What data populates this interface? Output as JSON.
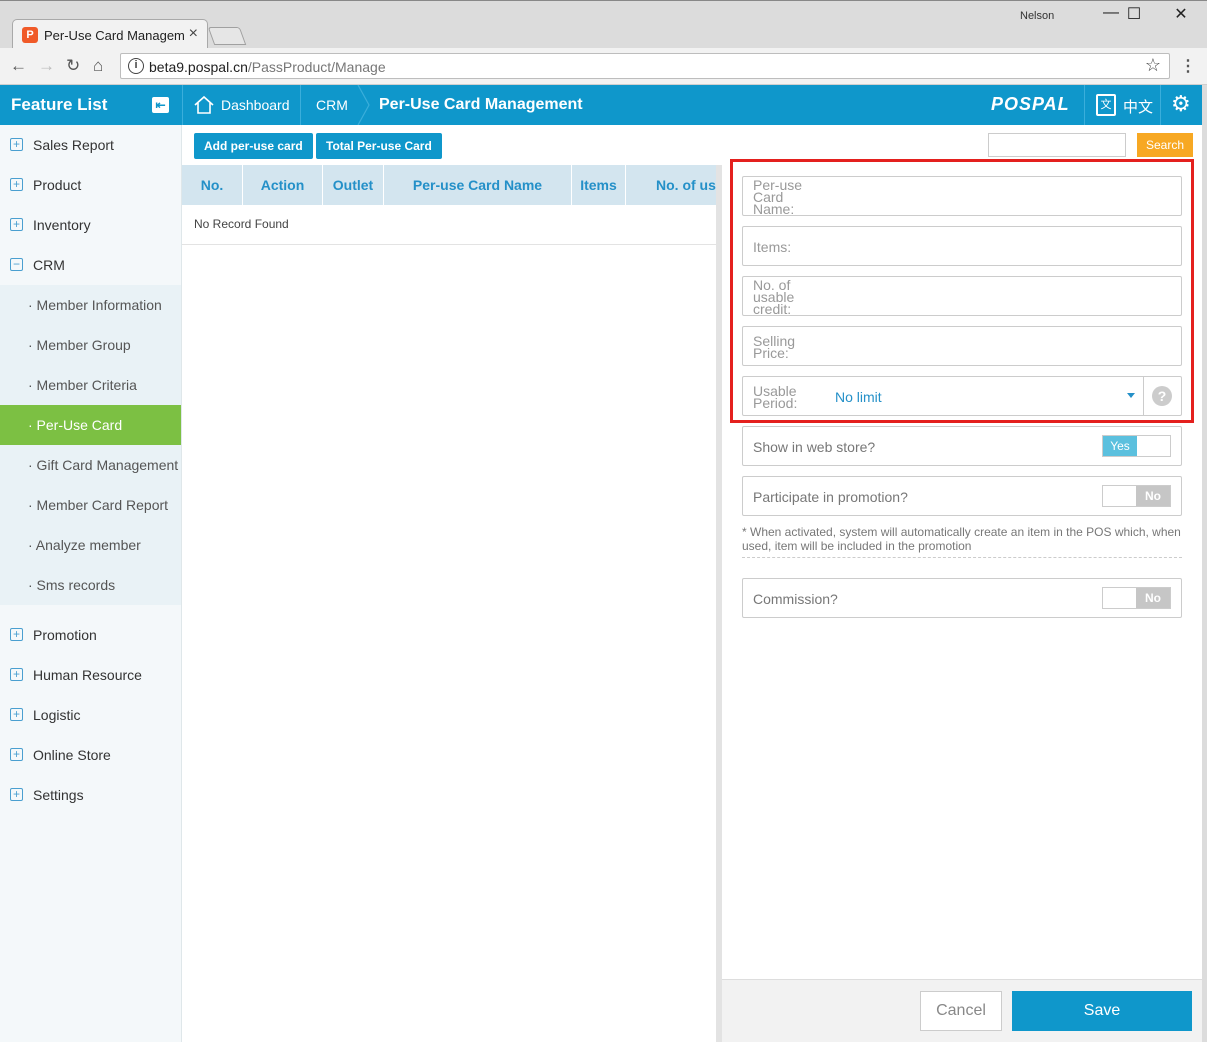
{
  "browser": {
    "tab_title": "Per-Use Card Management",
    "user": "Nelson",
    "url_host": "beta9.pospal.cn",
    "url_path": "/PassProduct/Manage"
  },
  "header": {
    "feature_title": "Feature List",
    "breadcrumbs": [
      "Dashboard",
      "CRM"
    ],
    "page_title": "Per-Use Card Management",
    "brand": "POSPAL",
    "lang_label": "中文",
    "accent_color": "#0f97cb"
  },
  "sidebar": {
    "items": [
      {
        "label": "Sales Report"
      },
      {
        "label": "Product"
      },
      {
        "label": "Inventory"
      },
      {
        "label": "CRM"
      },
      {
        "label": "Promotion"
      },
      {
        "label": "Human Resource"
      },
      {
        "label": "Logistic"
      },
      {
        "label": "Online Store"
      },
      {
        "label": "Settings"
      }
    ],
    "crm_sub": [
      {
        "label": "· Member Information"
      },
      {
        "label": "· Member Group"
      },
      {
        "label": "· Member Criteria"
      },
      {
        "label": "· Per-Use Card",
        "active": true
      },
      {
        "label": "· Gift Card Management"
      },
      {
        "label": "· Member Card Report"
      },
      {
        "label": "· Analyze member"
      },
      {
        "label": "· Sms records"
      }
    ],
    "active_color": "#7cc043"
  },
  "toolbar": {
    "add_label": "Add per-use card",
    "total_label": "Total Per-use Card",
    "search_label": "Search",
    "search_value": ""
  },
  "table": {
    "columns": [
      "No.",
      "Action",
      "Outlet",
      "Per-use Card Name",
      "Items",
      "No. of usable credit"
    ],
    "empty_text": "No Record Found"
  },
  "form": {
    "card_name_label": "Per-use Card Name:",
    "items_label": "Items:",
    "credit_label": "No. of usable credit:",
    "price_label": "Selling Price:",
    "period_label": "Usable Period:",
    "period_value": "No limit",
    "webstore_label": "Show in web store?",
    "webstore_value": "Yes",
    "promotion_label": "Participate in promotion?",
    "promotion_value": "No",
    "promotion_note": "* When activated, system will automatically create an item in the POS which, when used, item will be included in the promotion",
    "commission_label": "Commission?",
    "commission_value": "No",
    "cancel_label": "Cancel",
    "save_label": "Save",
    "highlight_color": "#e4201e"
  }
}
